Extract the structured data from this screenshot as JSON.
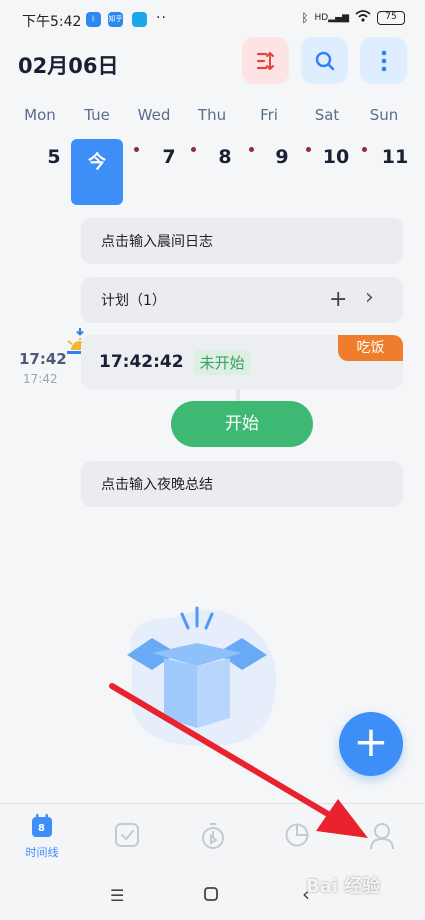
{
  "status_bar": {
    "time": "下午5:42",
    "app_icon_1": "bluetooth-icon",
    "app_icon_2": "知乎",
    "dots": "··",
    "signal_text": "HD",
    "battery": "75"
  },
  "header": {
    "date": "02月06日",
    "sort_icon": "sort-icon",
    "search_icon": "search-icon",
    "more_icon": "more-vertical-icon"
  },
  "week": {
    "days": [
      "Mon",
      "Tue",
      "Wed",
      "Thu",
      "Fri",
      "Sat",
      "Sun"
    ],
    "dates": [
      "5",
      "今",
      "7",
      "8",
      "9",
      "10",
      "11"
    ],
    "today_label": "今"
  },
  "cards": {
    "morning": "点击输入晨间日志",
    "plan": "计划（1）",
    "task_time": "17:42:42",
    "task_status": "未开始",
    "task_tag": "吃饭",
    "start_label": "开始",
    "night": "点击输入夜晚总结"
  },
  "timeline": {
    "time": "17:42",
    "sub_time": "17:42"
  },
  "tabs": {
    "timeline_badge": "8",
    "timeline_label": "时间线"
  },
  "watermark": "Bai 经验",
  "colors": {
    "accent": "#3e8ef7",
    "start_green": "#3eb973",
    "tag_orange": "#f07d2c",
    "arrow_red": "#e8232f"
  }
}
